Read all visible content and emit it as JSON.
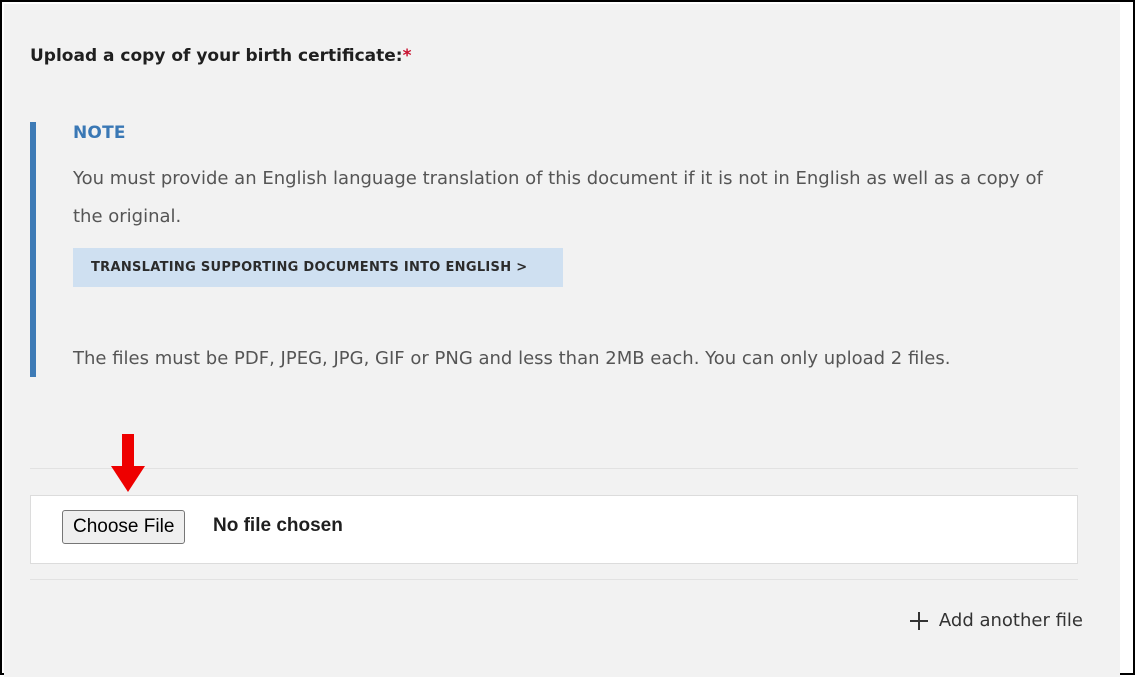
{
  "upload": {
    "label": "Upload a copy of your birth certificate:",
    "required_mark": "*"
  },
  "note": {
    "title": "NOTE",
    "body": "You must provide an English language translation of this document if it is not in English as well as a copy of the original.",
    "link_label": "TRANSLATING SUPPORTING DOCUMENTS INTO ENGLISH >",
    "file_rules": "The files must be PDF, JPEG, JPG, GIF or PNG and less than 2MB each. You can only upload 2 files."
  },
  "file_input": {
    "button_label": "Choose File",
    "status": "No file chosen"
  },
  "add_file_label": "Add another file",
  "annotation": {
    "arrow_icon": "red-down-arrow-icon",
    "color": "#ee0000"
  },
  "colors": {
    "accent": "#3e7bb6",
    "required": "#c8102e",
    "link_bg": "#cfe0f1",
    "panel_bg": "#f2f2f2"
  }
}
